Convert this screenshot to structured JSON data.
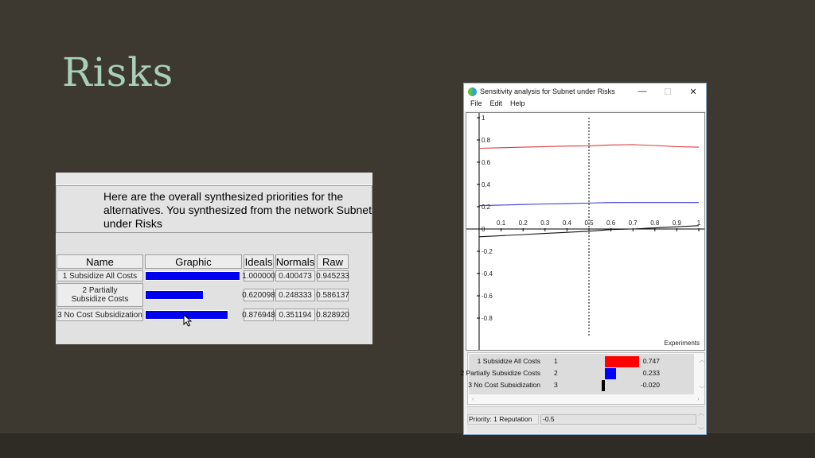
{
  "slide": {
    "title": "Risks"
  },
  "synth_panel": {
    "message": "Here are the overall synthesized priorities for the alternatives.  You synthesized from the network Subnet under Risks",
    "headers": {
      "name": "Name",
      "graphic": "Graphic",
      "ideals": "Ideals",
      "normals": "Normals",
      "raw": "Raw"
    },
    "bar_color": "#0000f0",
    "rows": [
      {
        "name": "1 Subsidize All Costs",
        "ideals": "1.000000",
        "normals": "0.400473",
        "raw": "0.945233",
        "ideal_value": 1.0
      },
      {
        "name": "2 Partially Subsidize Costs",
        "ideals": "0.620098",
        "normals": "0.248333",
        "raw": "0.586137",
        "ideal_value": 0.620098
      },
      {
        "name": "3 No Cost Subsidization",
        "ideals": "0.876948",
        "normals": "0.351194",
        "raw": "0.828920",
        "ideal_value": 0.876948
      }
    ]
  },
  "sensitivity_window": {
    "title": "Sensitivity analysis for Subnet under Risks",
    "controls": {
      "minimize": "—",
      "maximize": "☐",
      "close": "✕"
    },
    "menu": [
      "File",
      "Edit",
      "Help"
    ],
    "results": [
      {
        "name": "1 Subsidize All Costs",
        "index": "1",
        "value": "0.747",
        "num": 0.747,
        "color": "#ff0000"
      },
      {
        "name": "2 Partially Subsidize Costs",
        "index": "2",
        "value": "0.233",
        "num": 0.233,
        "color": "#0000ff"
      },
      {
        "name": "3 No Cost Subsidization",
        "index": "3",
        "value": "-0.020",
        "num": -0.02,
        "color": "#000000"
      }
    ],
    "priority_label": "Priority: 1 Reputation",
    "priority_value": "-0.5"
  },
  "chart_data": {
    "type": "line",
    "title": "",
    "xlabel": "Experiments",
    "ylabel": "",
    "xlim": [
      0,
      1
    ],
    "ylim": [
      -1,
      1
    ],
    "x_ticks": [
      "0.1",
      "0.2",
      "0.3",
      "0.4",
      "0.5",
      "0.6",
      "0.7",
      "0.8",
      "0.9",
      "1"
    ],
    "y_ticks": [
      "1",
      "0.8",
      "0.6",
      "0.4",
      "0.2",
      "0",
      "-0.2",
      "-0.4",
      "-0.6",
      "-0.8"
    ],
    "marker_x": 0.5,
    "x": [
      0,
      0.1,
      0.2,
      0.3,
      0.4,
      0.5,
      0.6,
      0.7,
      0.8,
      0.9,
      1.0
    ],
    "series": [
      {
        "name": "1 Subsidize All Costs",
        "color": "#e03a3a",
        "values": [
          0.725,
          0.73,
          0.735,
          0.74,
          0.745,
          0.747,
          0.755,
          0.758,
          0.75,
          0.74,
          0.735
        ]
      },
      {
        "name": "2 Partially Subsidize Costs",
        "color": "#3a3ad0",
        "values": [
          0.21,
          0.215,
          0.22,
          0.225,
          0.228,
          0.233,
          0.238,
          0.238,
          0.238,
          0.238,
          0.238
        ]
      },
      {
        "name": "3 No Cost Subsidization",
        "color": "#111111",
        "values": [
          -0.07,
          -0.06,
          -0.05,
          -0.04,
          -0.03,
          -0.02,
          -0.005,
          0.0,
          0.01,
          0.02,
          0.03
        ]
      }
    ]
  }
}
